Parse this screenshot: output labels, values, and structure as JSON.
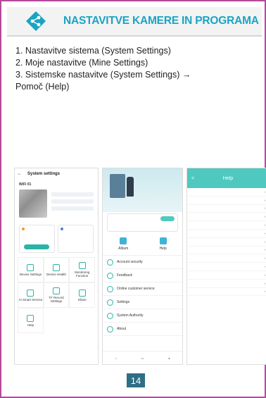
{
  "header": {
    "title": "NASTAVITVE KAMERE IN PROGRAMA",
    "logo_icon": "share-icon",
    "accent_color": "#1aa4c4",
    "border_color": "#b24a9b"
  },
  "steps": [
    "1. Nastavitve sistema (System Settings)",
    "2. Moje nastavitve (Mine Settings)",
    "3. Sistemske nastavitve (System Settings) →",
    "Pomoč (Help)"
  ],
  "screen1": {
    "back": "←",
    "title": "System settings",
    "wifi": "WiFi 01",
    "grid": [
      "Device Settings",
      "Device Health",
      "Monitoring Function",
      "AI Smart Service",
      "TF Record Settings",
      "Share",
      "Help"
    ]
  },
  "screen2": {
    "album": "Album",
    "help": "Help",
    "menu": [
      "Account security",
      "Feedback",
      "Online customer service",
      "Settings",
      "System Authority",
      "About"
    ]
  },
  "screen3": {
    "back": "<",
    "title": "Help"
  },
  "page_number": "14"
}
